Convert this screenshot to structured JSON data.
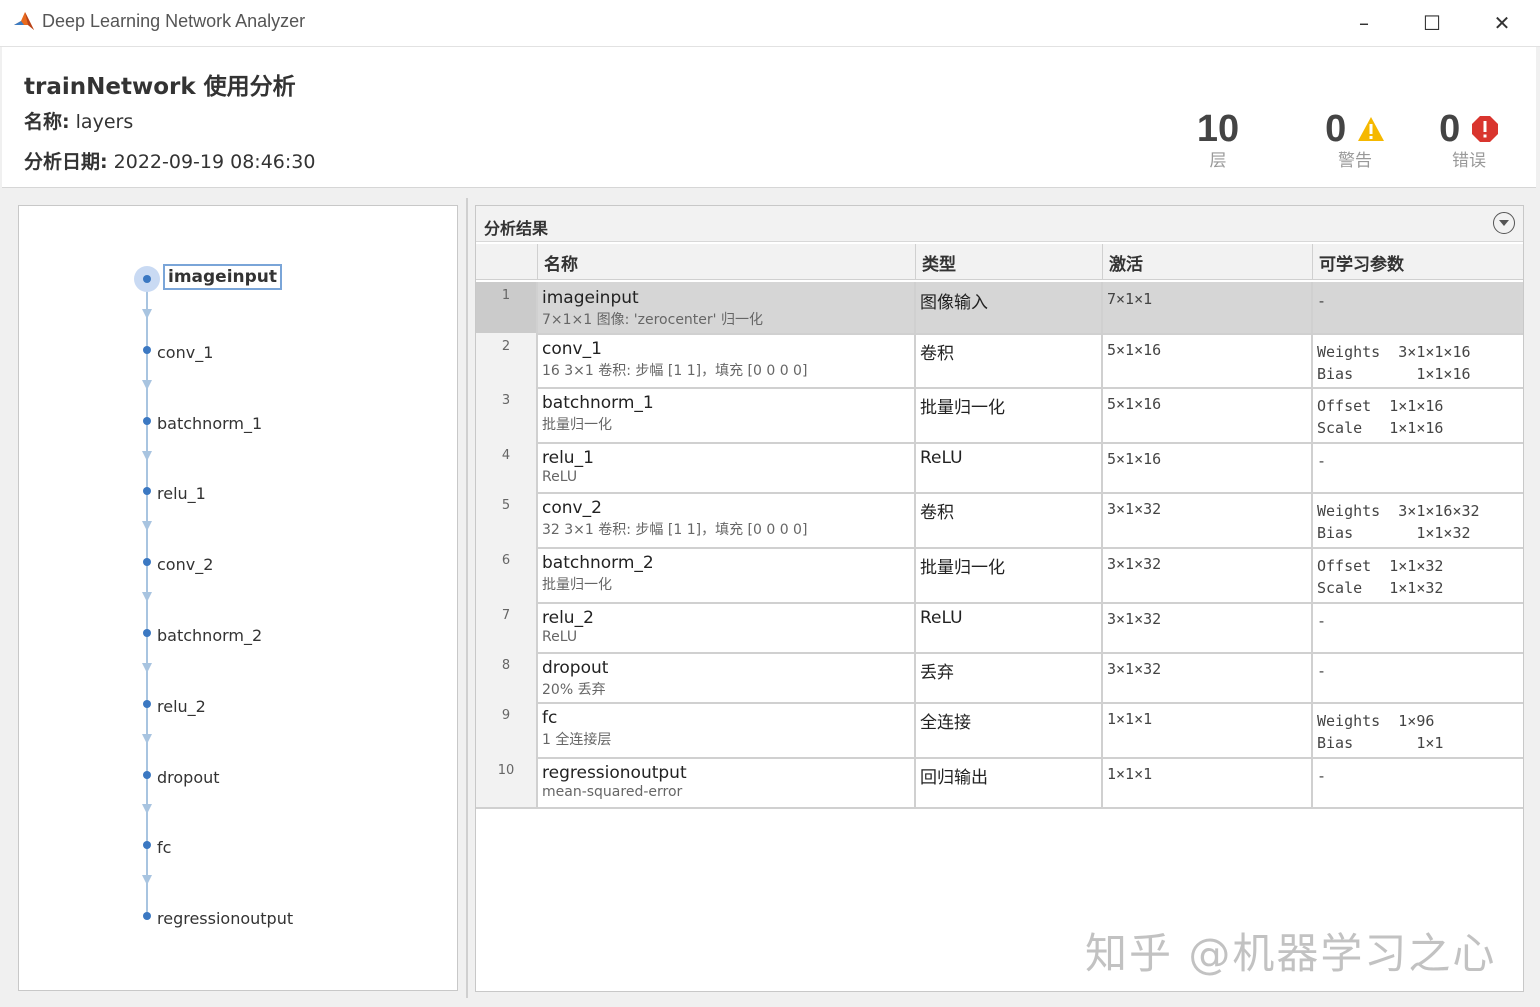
{
  "window": {
    "title": "Deep Learning Network Analyzer"
  },
  "header": {
    "title": "trainNetwork 使用分析",
    "name_label": "名称:",
    "name_value": "layers",
    "date_label": "分析日期:",
    "date_value": "2022-09-19 08:46:30",
    "layers_count": "10",
    "layers_label": "层",
    "warnings_count": "0",
    "warnings_label": "警告",
    "errors_count": "0",
    "errors_label": "错误"
  },
  "graph": {
    "nodes": [
      "imageinput",
      "conv_1",
      "batchnorm_1",
      "relu_1",
      "conv_2",
      "batchnorm_2",
      "relu_2",
      "dropout",
      "fc",
      "regressionoutput"
    ]
  },
  "results": {
    "title": "分析结果",
    "columns": {
      "name": "名称",
      "type": "类型",
      "activation": "激活",
      "params": "可学习参数"
    },
    "rows": [
      {
        "idx": "1",
        "name": "imageinput",
        "desc": "7×1×1 图像: 'zerocenter' 归一化",
        "type": "图像输入",
        "act": "7×1×1",
        "params": "-"
      },
      {
        "idx": "2",
        "name": "conv_1",
        "desc": "16 3×1 卷积: 步幅 [1 1]，填充 [0 0 0 0]",
        "type": "卷积",
        "act": "5×1×16",
        "params": "Weights  3×1×1×16\nBias       1×1×16"
      },
      {
        "idx": "3",
        "name": "batchnorm_1",
        "desc": "批量归一化",
        "type": "批量归一化",
        "act": "5×1×16",
        "params": "Offset  1×1×16\nScale   1×1×16"
      },
      {
        "idx": "4",
        "name": "relu_1",
        "desc": "ReLU",
        "type": "ReLU",
        "act": "5×1×16",
        "params": "-"
      },
      {
        "idx": "5",
        "name": "conv_2",
        "desc": "32 3×1 卷积: 步幅 [1 1]，填充 [0 0 0 0]",
        "type": "卷积",
        "act": "3×1×32",
        "params": "Weights  3×1×16×32\nBias       1×1×32"
      },
      {
        "idx": "6",
        "name": "batchnorm_2",
        "desc": "批量归一化",
        "type": "批量归一化",
        "act": "3×1×32",
        "params": "Offset  1×1×32\nScale   1×1×32"
      },
      {
        "idx": "7",
        "name": "relu_2",
        "desc": "ReLU",
        "type": "ReLU",
        "act": "3×1×32",
        "params": "-"
      },
      {
        "idx": "8",
        "name": "dropout",
        "desc": "20% 丢弃",
        "type": "丢弃",
        "act": "3×1×32",
        "params": "-"
      },
      {
        "idx": "9",
        "name": "fc",
        "desc": "1 全连接层",
        "type": "全连接",
        "act": "1×1×1",
        "params": "Weights  1×96\nBias       1×1"
      },
      {
        "idx": "10",
        "name": "regressionoutput",
        "desc": "mean-squared-error",
        "type": "回归输出",
        "act": "1×1×1",
        "params": "-"
      }
    ]
  },
  "watermark": "知乎 @机器学习之心",
  "colors": {
    "accent": "#3b78c2",
    "warning": "#f5b800",
    "error": "#d9352e"
  }
}
